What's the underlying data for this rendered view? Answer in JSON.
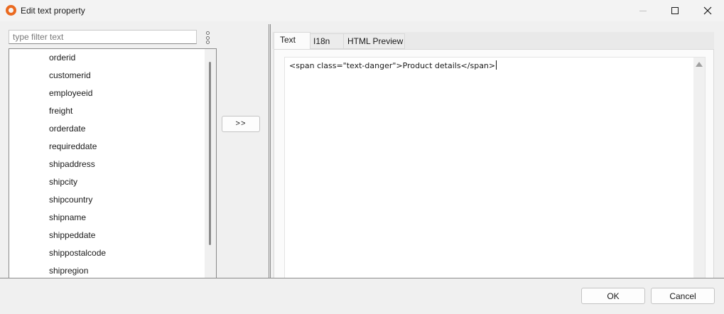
{
  "window": {
    "title": "Edit text property",
    "app_icon": "app-logo-icon",
    "controls": [
      "minimize-icon",
      "maximize-icon",
      "close-icon"
    ]
  },
  "filter": {
    "placeholder": "type filter text",
    "value": "",
    "menu_icon": "kebab-menu-icon"
  },
  "fields": {
    "items": [
      "orderid",
      "customerid",
      "employeeid",
      "freight",
      "orderdate",
      "requireddate",
      "shipaddress",
      "shipcity",
      "shipcountry",
      "shipname",
      "shippeddate",
      "shippostalcode",
      "shipregion"
    ]
  },
  "add_button": {
    "label": ">>"
  },
  "tabs": [
    {
      "label": "Text",
      "active": true
    },
    {
      "label": "I18n",
      "active": false
    },
    {
      "label": "HTML Preview",
      "active": false
    }
  ],
  "editor": {
    "content": "<span class=\"text-danger\">Product details</span>"
  },
  "footer": {
    "ok_label": "OK",
    "cancel_label": "Cancel"
  },
  "colors": {
    "accent": "#ea6a20",
    "background": "#f0f0f0"
  }
}
